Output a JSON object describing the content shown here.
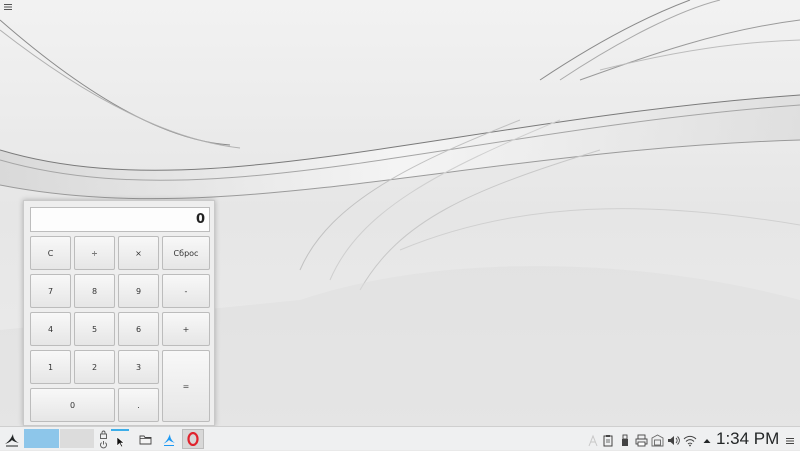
{
  "desktop": {
    "menu_icon": "hamburger-icon"
  },
  "calculator": {
    "display": "0",
    "keys": {
      "clear": "C",
      "divide": "÷",
      "multiply": "×",
      "reset": "Сброс",
      "seven": "7",
      "eight": "8",
      "nine": "9",
      "minus": "-",
      "four": "4",
      "five": "5",
      "six": "6",
      "plus": "+",
      "one": "1",
      "two": "2",
      "three": "3",
      "equals": "=",
      "zero": "0",
      "decimal": "."
    }
  },
  "taskbar": {
    "launcher_icon": "kde-launcher-icon",
    "lock_icon": "lock-icon",
    "power_icon": "power-icon",
    "files_icon": "folder-icon",
    "app_icon": "kde-app-icon",
    "browser_icon": "opera-icon",
    "tray_icons": [
      "input-icon",
      "clipboard-icon",
      "usb-icon",
      "printer-icon",
      "vault-icon",
      "volume-icon",
      "wifi-icon",
      "expand-arrow-icon"
    ],
    "clock": "1:34 PM",
    "menu_icon": "hamburger-icon"
  }
}
